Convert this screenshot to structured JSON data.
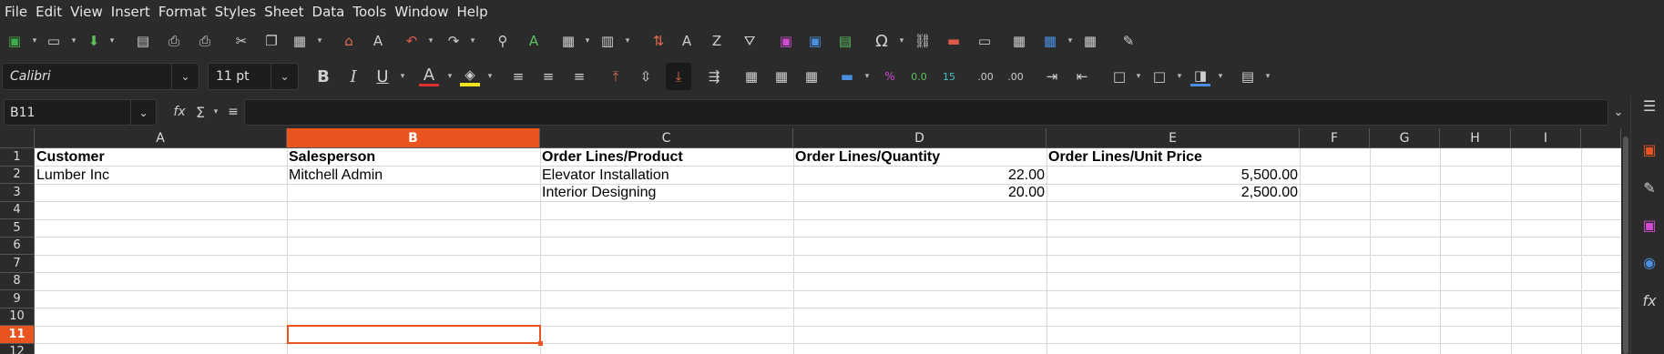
{
  "menu": [
    "File",
    "Edit",
    "View",
    "Insert",
    "Format",
    "Styles",
    "Sheet",
    "Data",
    "Tools",
    "Window",
    "Help"
  ],
  "formatting": {
    "font_name": "Calibri",
    "font_size": "11 pt"
  },
  "formula_bar": {
    "cell_ref": "B11",
    "content": ""
  },
  "grid": {
    "columns": [
      "A",
      "B",
      "C",
      "D",
      "E",
      "F",
      "G",
      "H",
      "I"
    ],
    "selected_column": "B",
    "rows": [
      "1",
      "2",
      "3",
      "4",
      "5",
      "6",
      "7",
      "8",
      "9",
      "10",
      "11",
      "12"
    ],
    "selected_row": "11",
    "cells": {
      "A1": "Customer",
      "B1": "Salesperson",
      "C1": "Order Lines/Product",
      "D1": "Order Lines/Quantity",
      "E1": "Order Lines/Unit Price",
      "A2": "Lumber Inc",
      "B2": "Mitchell Admin",
      "C2": "Elevator Installation",
      "D2": "22.00",
      "E2": "5,500.00",
      "C3": "Interior Designing",
      "D3": "20.00",
      "E3": "2,500.00"
    }
  },
  "colors": {
    "accent": "#e95420",
    "chrome": "#2b2b2b",
    "sheet_bg": "#ffffff"
  },
  "icons": {
    "toolbar1": [
      "new-document-icon",
      "open-icon",
      "save-icon",
      "export-pdf-icon",
      "print-icon",
      "print-preview-icon",
      "cut-icon",
      "copy-icon",
      "paste-icon",
      "clone-formatting-icon",
      "clear-formatting-icon",
      "undo-icon",
      "redo-icon",
      "find-replace-icon",
      "spelling-icon",
      "row-icon",
      "column-icon",
      "sort-icon",
      "sort-ascending-icon",
      "sort-descending-icon",
      "autofilter-icon",
      "image-icon",
      "chart-icon",
      "pivot-table-icon",
      "special-character-icon",
      "hyperlink-icon",
      "comment-icon",
      "header-footer-icon",
      "define-print-area-icon",
      "freeze-rows-columns-icon",
      "split-window-icon",
      "show-draw-functions-icon"
    ],
    "toolbar2": [
      "bold-icon",
      "italic-icon",
      "underline-icon",
      "font-color-icon",
      "highlight-color-icon",
      "align-left-icon",
      "align-center-icon",
      "align-right-icon",
      "align-top-icon",
      "center-vertically-icon",
      "align-bottom-icon",
      "wrap-text-icon",
      "merge-center-icon",
      "merge-cells-icon",
      "unmerge-cells-icon",
      "currency-icon",
      "percent-icon",
      "number-icon",
      "date-icon",
      "add-decimal-icon",
      "delete-decimal-icon",
      "increase-indent-icon",
      "decrease-indent-icon",
      "borders-icon",
      "border-style-icon",
      "border-color-icon",
      "conditional-icon"
    ],
    "sidebar": [
      "sidebar-menu-icon",
      "properties-icon",
      "styles-icon",
      "gallery-icon",
      "navigator-icon",
      "functions-icon"
    ]
  }
}
